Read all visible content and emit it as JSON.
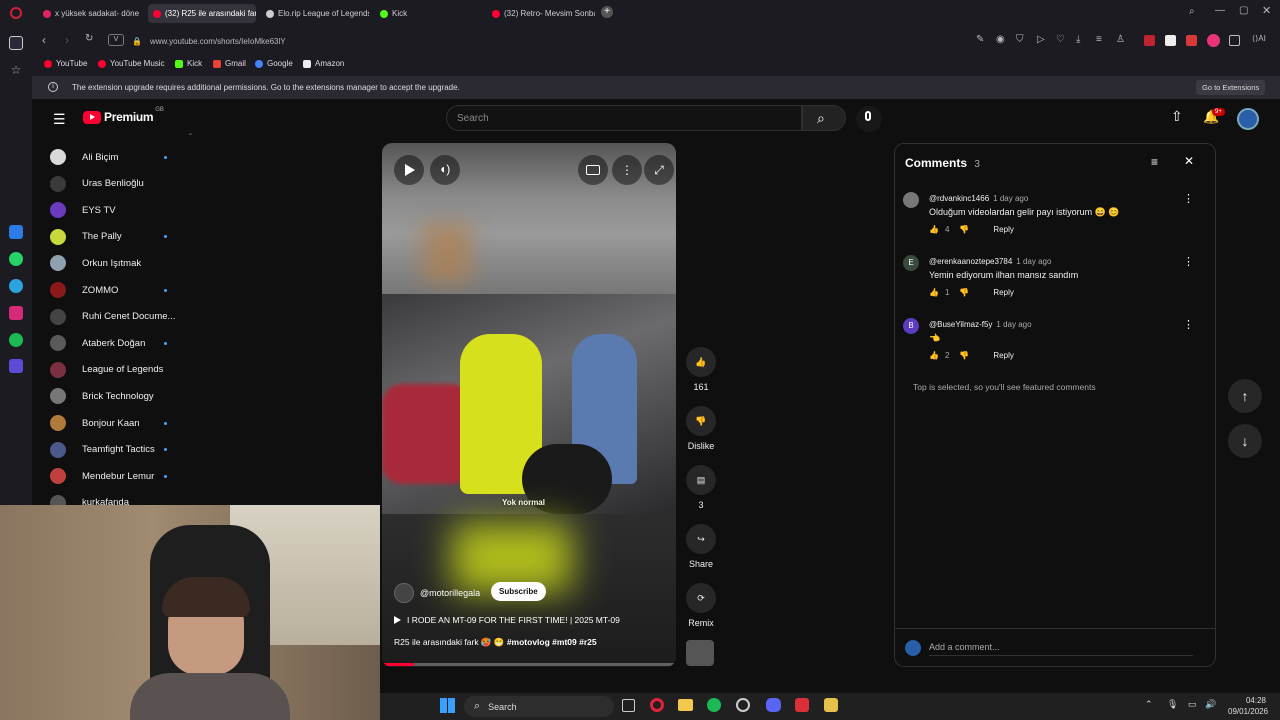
{
  "browser": {
    "tabs": [
      {
        "label": "x yüksek sadakat- döne",
        "color": "#e0245e",
        "active": false
      },
      {
        "label": "(32) R25 ile arasındaki fark",
        "color": "#ff0033",
        "active": true
      },
      {
        "label": "Elo.rip League of Legends",
        "color": "#cccccc",
        "active": false
      },
      {
        "label": "Kick",
        "color": "#53fc18",
        "active": false
      },
      {
        "label": "(32) Retro- Mevsim Sonba",
        "color": "#ff0033",
        "active": false
      }
    ],
    "url": "www.youtube.com/shorts/IeIoMke63lY",
    "url_badge": "V",
    "bookmarks": [
      "YouTube",
      "YouTube Music",
      "Kick",
      "Gmail",
      "Google",
      "Amazon"
    ],
    "infobar_text": "The extension upgrade requires additional permissions. Go to the extensions manager to accept the upgrade.",
    "infobar_button": "Go to Extensions"
  },
  "youtube": {
    "logo": "Premium",
    "logo_region": "GB",
    "search_placeholder": "Search",
    "notification_badge": "9+",
    "subscriptions": [
      {
        "name": "Ali Biçim",
        "live": true,
        "color": "#d9d9d9"
      },
      {
        "name": "Uras Benlioğlu",
        "live": false,
        "color": "#3a3a3a"
      },
      {
        "name": "EYS TV",
        "live": false,
        "color": "#6a3bbf"
      },
      {
        "name": "The Pally",
        "live": true,
        "color": "#c8d93b"
      },
      {
        "name": "Orkun Işıtmak",
        "live": false,
        "color": "#8fa0b0"
      },
      {
        "name": "ZOMMO",
        "live": true,
        "color": "#8a1a1a"
      },
      {
        "name": "Ruhi Cenet Docume...",
        "live": false,
        "color": "#444"
      },
      {
        "name": "Ataberk Doğan",
        "live": true,
        "color": "#5a5a5a"
      },
      {
        "name": "League of Legends",
        "live": false,
        "color": "#7a3040"
      },
      {
        "name": "Brick Technology",
        "live": false,
        "color": "#777"
      },
      {
        "name": "Bonjour Kaan",
        "live": true,
        "color": "#b07a3a"
      },
      {
        "name": "Teamfight Tactics",
        "live": true,
        "color": "#4a5a8a"
      },
      {
        "name": "Mendebur Lemur",
        "live": true,
        "color": "#c04040"
      },
      {
        "name": "kurkafanda",
        "live": false,
        "color": "#555"
      }
    ],
    "short": {
      "channel": "@motorillegala",
      "subscribe_label": "Subscribe",
      "related_title": "I RODE AN MT-09 FOR THE FIRST TIME! | 2025 MT-09",
      "caption": "R25 ile arasındaki fark 🥵 😁 ",
      "hashtags": "#motovlog #mt09 #r25",
      "subtitle_overlay": "Yok normal"
    },
    "actions": {
      "likes": "161",
      "dislike_label": "Dislike",
      "comments_count": "3",
      "share_label": "Share",
      "remix_label": "Remix"
    },
    "comments_panel": {
      "title": "Comments",
      "count": "3",
      "comments": [
        {
          "handle": "@rdvankinc1466",
          "time": "1 day ago",
          "text": "Olduğum videolardan gelir payı istiyorum 😄 😊",
          "likes": "4",
          "avatar_letter": "",
          "avatar_color": "#777"
        },
        {
          "handle": "@erenkaanoztepe3784",
          "time": "1 day ago",
          "text": "Yemin ediyorum ilhan mansız sandım",
          "likes": "1",
          "avatar_letter": "E",
          "avatar_color": "#3a4a3a"
        },
        {
          "handle": "@BuseYilmaz-f5y",
          "time": "1 day ago",
          "text": "👈",
          "likes": "2",
          "avatar_letter": "B",
          "avatar_color": "#5c3bbf"
        }
      ],
      "reply_label": "Reply",
      "footer_note": "Top is selected, so you'll see featured comments",
      "add_comment_placeholder": "Add a comment..."
    }
  },
  "taskbar": {
    "search_label": "Search",
    "time": "04:28",
    "date": "09/01/2026"
  }
}
